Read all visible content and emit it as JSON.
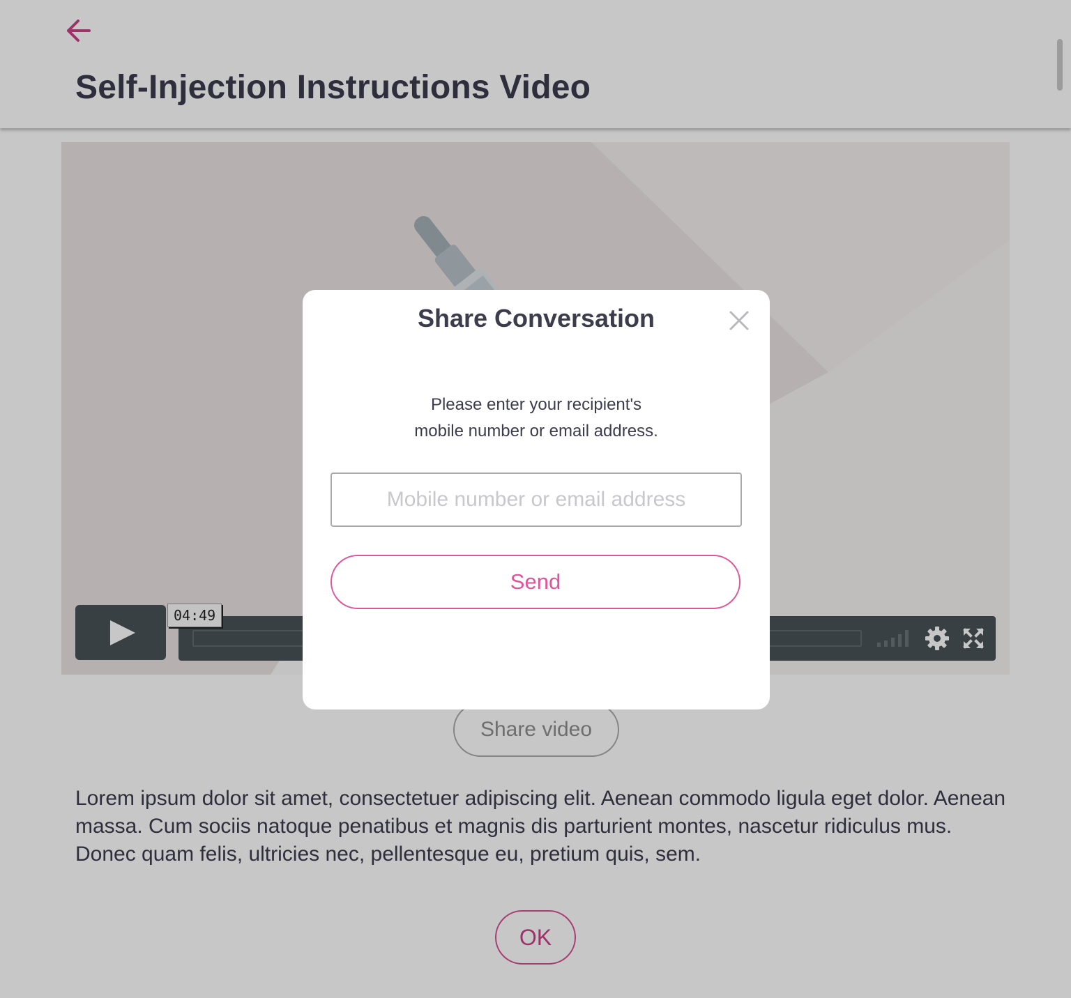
{
  "header": {
    "title": "Self-Injection Instructions Video",
    "back_icon": "arrow-left-icon"
  },
  "video": {
    "time_tooltip": "04:49",
    "controls": [
      "play-icon",
      "volume-icon",
      "gear-icon",
      "fullscreen-icon"
    ]
  },
  "actions": {
    "share_video_label": "Share video",
    "ok_label": "OK"
  },
  "body_text": "Lorem ipsum dolor sit amet, consectetuer adipiscing elit. Aenean commodo ligula eget dolor. Aenean massa. Cum sociis natoque penatibus et magnis dis parturient montes, nascetur ridiculus mus. Donec quam felis, ultricies nec, pellentesque eu, pretium quis, sem.",
  "modal": {
    "title": "Share Conversation",
    "instruction_line1": "Please enter your recipient's",
    "instruction_line2": "mobile number or email address.",
    "input_placeholder": "Mobile number or email address",
    "input_value": "",
    "send_label": "Send",
    "close_icon": "close-icon"
  },
  "colors": {
    "accent": "#e0559a",
    "text_dark": "#3c3c4d",
    "border_gray": "#a9a9a9",
    "player_bar": "#4a5358"
  }
}
